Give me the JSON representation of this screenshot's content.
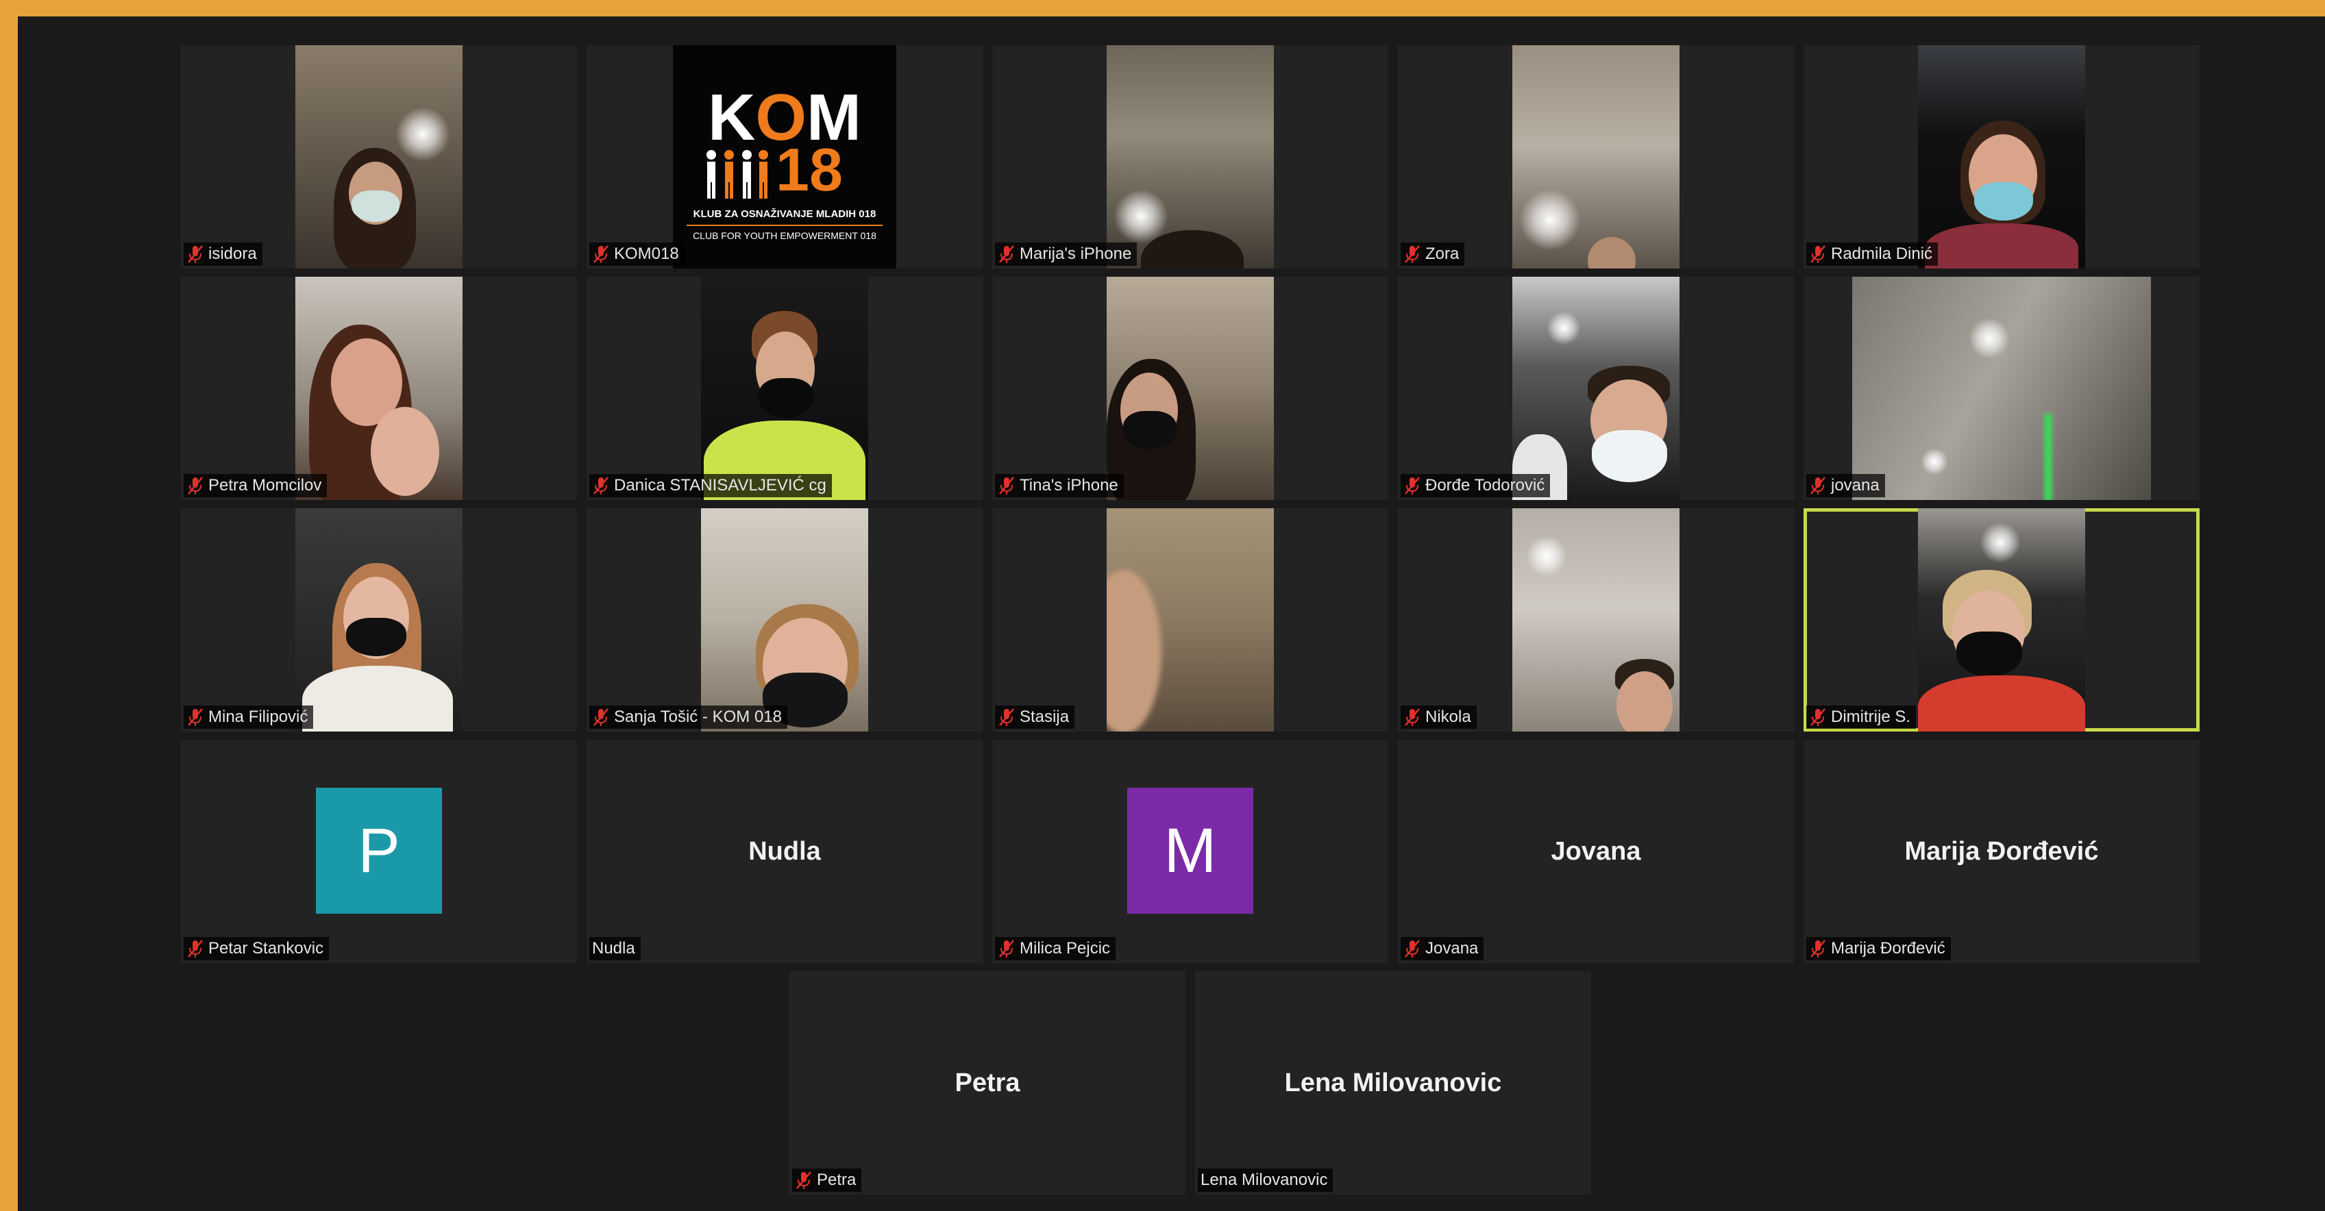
{
  "meeting": {
    "tiles": [
      {
        "name": "isidora",
        "muted": true
      },
      {
        "name": "KOM018",
        "muted": true,
        "logo": {
          "line_top": "K",
          "line_top_o": "O",
          "line_top_end": "M",
          "number": "18",
          "subtitle": "KLUB ZA OSNAŽIVANJE MLADIH 018",
          "subtitle_en": "CLUB FOR YOUTH EMPOWERMENT 018"
        }
      },
      {
        "name": "Marija's iPhone",
        "muted": true
      },
      {
        "name": "Zora",
        "muted": true
      },
      {
        "name": "Radmila Dinić",
        "muted": true
      },
      {
        "name": "Petra Momcilov",
        "muted": true
      },
      {
        "name": "Danica STANISAVLJEVIĆ cg",
        "muted": true
      },
      {
        "name": "Tina's iPhone",
        "muted": true
      },
      {
        "name": "Đorđe Todorović",
        "muted": true
      },
      {
        "name": "jovana",
        "muted": true
      },
      {
        "name": "Mina Filipović",
        "muted": true
      },
      {
        "name": "Sanja Tošić - KOM 018",
        "muted": true
      },
      {
        "name": "Stasija",
        "muted": true
      },
      {
        "name": "Nikola",
        "muted": true
      },
      {
        "name": "Dimitrije S.",
        "muted": true,
        "active_speaker": true
      },
      {
        "name": "Petar Stankovic",
        "muted": true,
        "avatar_letter": "P",
        "avatar_color": "#1a9aa8"
      },
      {
        "name": "Nudla",
        "muted": false,
        "display_name": "Nudla"
      },
      {
        "name": "Milica Pejcic",
        "muted": true,
        "avatar_letter": "M",
        "avatar_color": "#7b2aa8"
      },
      {
        "name": "Jovana",
        "muted": true,
        "display_name": "Jovana"
      },
      {
        "name": "Marija Đorđević",
        "muted": true,
        "display_name": "Marija Đorđević"
      },
      {
        "name": "Petra",
        "muted": true,
        "display_name": "Petra"
      },
      {
        "name": "Lena Milovanovic",
        "muted": false,
        "display_name": "Lena Milovanovic"
      }
    ]
  },
  "colors": {
    "border": "#e8a33a",
    "background": "#1a1a1a",
    "tile": "#232323",
    "active_speaker_outline": "#c9d94a",
    "mute_icon": "#e0322a"
  }
}
